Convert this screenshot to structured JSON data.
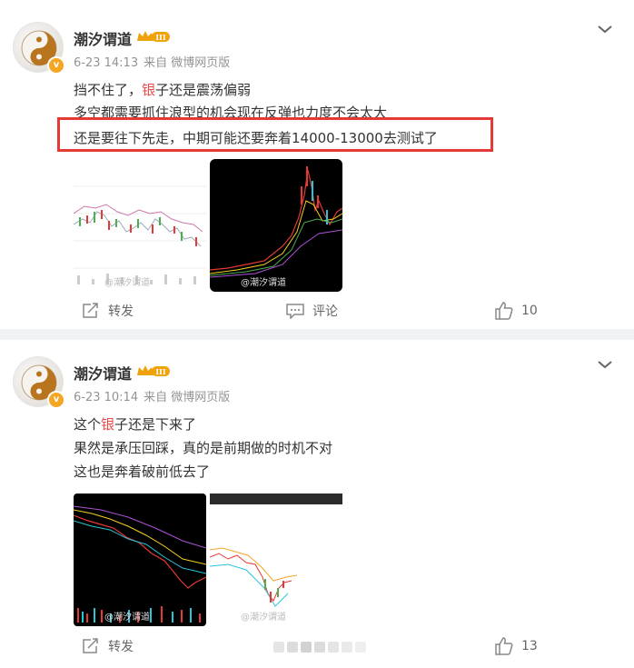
{
  "posts": [
    {
      "username": "潮汐谓道",
      "level_badge": "III",
      "date": "6-23 14:13",
      "source": "来自 微博网页版",
      "lines": [
        {
          "pre": "挡不住了，",
          "hl": "银",
          "post": "子还是震荡偏弱"
        },
        {
          "pre": "多空都需要抓住浪型的机会现在反弹也力度不会太大",
          "hl": "",
          "post": ""
        },
        {
          "pre": "还是要往下先走，中期可能还要奔着14000-13000去测试了",
          "hl": "",
          "post": ""
        }
      ],
      "image_watermarks": [
        "@潮汐谓道",
        "@潮汐谓道"
      ],
      "actions": {
        "repost": "转发",
        "comment": "评论",
        "like_count": "10"
      }
    },
    {
      "username": "潮汐谓道",
      "level_badge": "III",
      "date": "6-23 10:14",
      "source": "来自 微博网页版",
      "lines": [
        {
          "pre": "这个",
          "hl": "银",
          "post": "子还是下来了"
        },
        {
          "pre": "果然是承压回踩，真的是前期做的时机不对",
          "hl": "",
          "post": ""
        },
        {
          "pre": "这也是奔着破前低去了",
          "hl": "",
          "post": ""
        }
      ],
      "image_watermarks": [
        "@潮汐谓道",
        "@潮汐谓道"
      ],
      "actions": {
        "repost": "转发",
        "like_count": "13"
      }
    }
  ],
  "colors": {
    "highlight": "#eb4a4a",
    "annotation_box": "#e53935",
    "badge": "#f5a623"
  }
}
